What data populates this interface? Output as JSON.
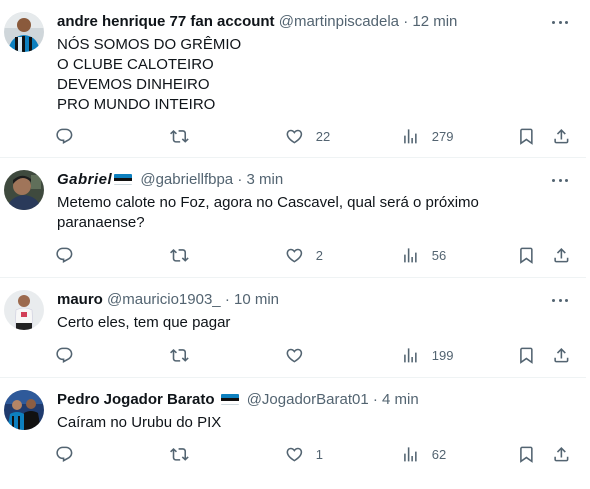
{
  "posts": [
    {
      "name": "andre henrique 77 fan account",
      "handle": "@martinpiscadela",
      "dot": "·",
      "time": "12 min",
      "lines": [
        "NÓS SOMOS DO GRÊMIO",
        "O CLUBE CALOTEIRO",
        "DEVEMOS DINHEIRO",
        "PRO MUNDO INTEIRO"
      ],
      "replies": "",
      "reposts": "",
      "likes": "22",
      "views": "279"
    },
    {
      "name": "Gabriel",
      "handle": "@gabriellfbpa",
      "dot": "·",
      "time": "3 min",
      "lines": [
        "Metemo calote no Foz, agora no Cascavel, qual será o próximo",
        "paranaense?"
      ],
      "replies": "",
      "reposts": "",
      "likes": "2",
      "views": "56"
    },
    {
      "name": "mauro",
      "handle": "@mauricio1903_",
      "dot": "·",
      "time": "10 min",
      "lines": [
        "Certo eles, tem que pagar"
      ],
      "replies": "",
      "reposts": "",
      "likes": "",
      "views": "199"
    },
    {
      "name": "Pedro Jogador Barato",
      "handle": "@JogadorBarat01",
      "dot": "·",
      "time": "4 min",
      "lines": [
        "Caíram no Urubu do PIX"
      ],
      "replies": "",
      "reposts": "",
      "likes": "1",
      "views": "62"
    }
  ],
  "flag_colors": [
    "#0d80bf",
    "#111111",
    "#ffffff"
  ],
  "icons": [
    "reply-icon",
    "repost-icon",
    "like-icon",
    "views-icon",
    "bookmark-icon",
    "share-icon",
    "more-icon",
    "tricolor-flag-icon"
  ]
}
